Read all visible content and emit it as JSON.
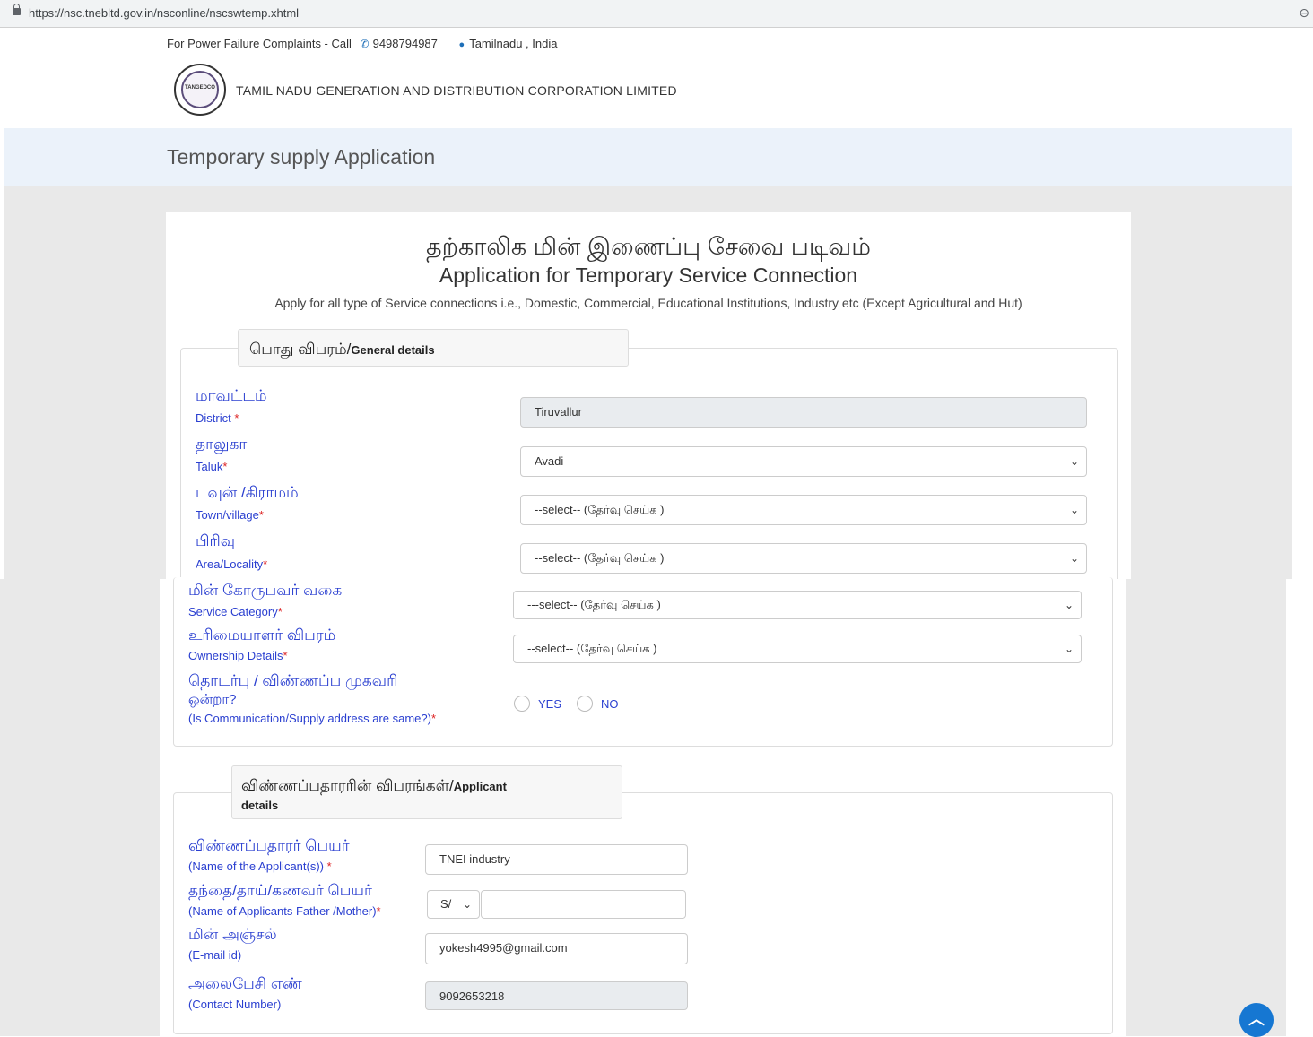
{
  "browser": {
    "url": "https://nsc.tnebltd.gov.in/nsconline/nscswtemp.xhtml"
  },
  "header": {
    "complaint_text": "For Power Failure Complaints - Call",
    "phone": "9498794987",
    "location": "Tamilnadu , India",
    "logo_text": "TANGEDCO",
    "org_name": "TAMIL NADU GENERATION AND DISTRIBUTION CORPORATION LIMITED",
    "page_title": "Temporary supply Application"
  },
  "form": {
    "title_ta": "தற்காலிக மின் இணைப்பு சேவை படிவம்",
    "title_en": "Application for Temporary Service Connection",
    "subtitle": "Apply for all type of Service connections i.e., Domestic, Commercial, Educational Institutions, Industry etc (Except Agricultural and Hut)"
  },
  "general": {
    "legend_ta": "பொது விபரம்/",
    "legend_en": "General details",
    "district": {
      "label_ta": "மாவட்டம்",
      "label_en": "District",
      "value": "Tiruvallur"
    },
    "taluk": {
      "label_ta": "தாலுகா",
      "label_en": "Taluk",
      "value": "Avadi"
    },
    "town": {
      "label_ta": "டவுன் /கிராமம்",
      "label_en": "Town/village",
      "value": "--select-- (தேர்வு செய்க )"
    },
    "area": {
      "label_ta": "பிரிவு",
      "label_en": "Area/Locality",
      "value": "--select-- (தேர்வு செய்க )"
    },
    "category": {
      "label_ta": "மின் கோருபவர் வகை",
      "label_en": "Service Category",
      "value": "---select-- (தேர்வு செய்க )"
    },
    "ownership": {
      "label_ta": "உரிமையாளர் விபரம்",
      "label_en": "Ownership Details",
      "value": "--select-- (தேர்வு செய்க )"
    },
    "same_address": {
      "label_ta_1": "தொடர்பு / விண்ணப்ப முகவரி",
      "label_ta_2": "ஒன்றா?",
      "label_en": "(Is Communication/Supply address are same?)",
      "yes": "YES",
      "no": "NO"
    }
  },
  "applicant": {
    "legend_ta": "விண்ணப்பதாரரின் விபரங்கள்/",
    "legend_en_1": "Applicant",
    "legend_en_2": "details",
    "name": {
      "label_ta": "விண்ணப்பதாரர் பெயர்",
      "label_en": "(Name of the Applicant(s))",
      "value": "TNEI industry"
    },
    "father": {
      "label_ta": "தந்தை/தாய்/கணவர் பெயர்",
      "label_en": "(Name of Applicants Father /Mother)",
      "prefix": "S/",
      "value": ""
    },
    "email": {
      "label_ta": "மின் அஞ்சல்",
      "label_en": "(E-mail id)",
      "value": "yokesh4995@gmail.com"
    },
    "contact": {
      "label_ta": "அலைபேசி எண்",
      "label_en": "(Contact Number)",
      "value": "9092653218"
    }
  },
  "colors": {
    "label_blue": "#2a3fd0",
    "accent": "#1677d2",
    "band": "#ebf2fa"
  }
}
